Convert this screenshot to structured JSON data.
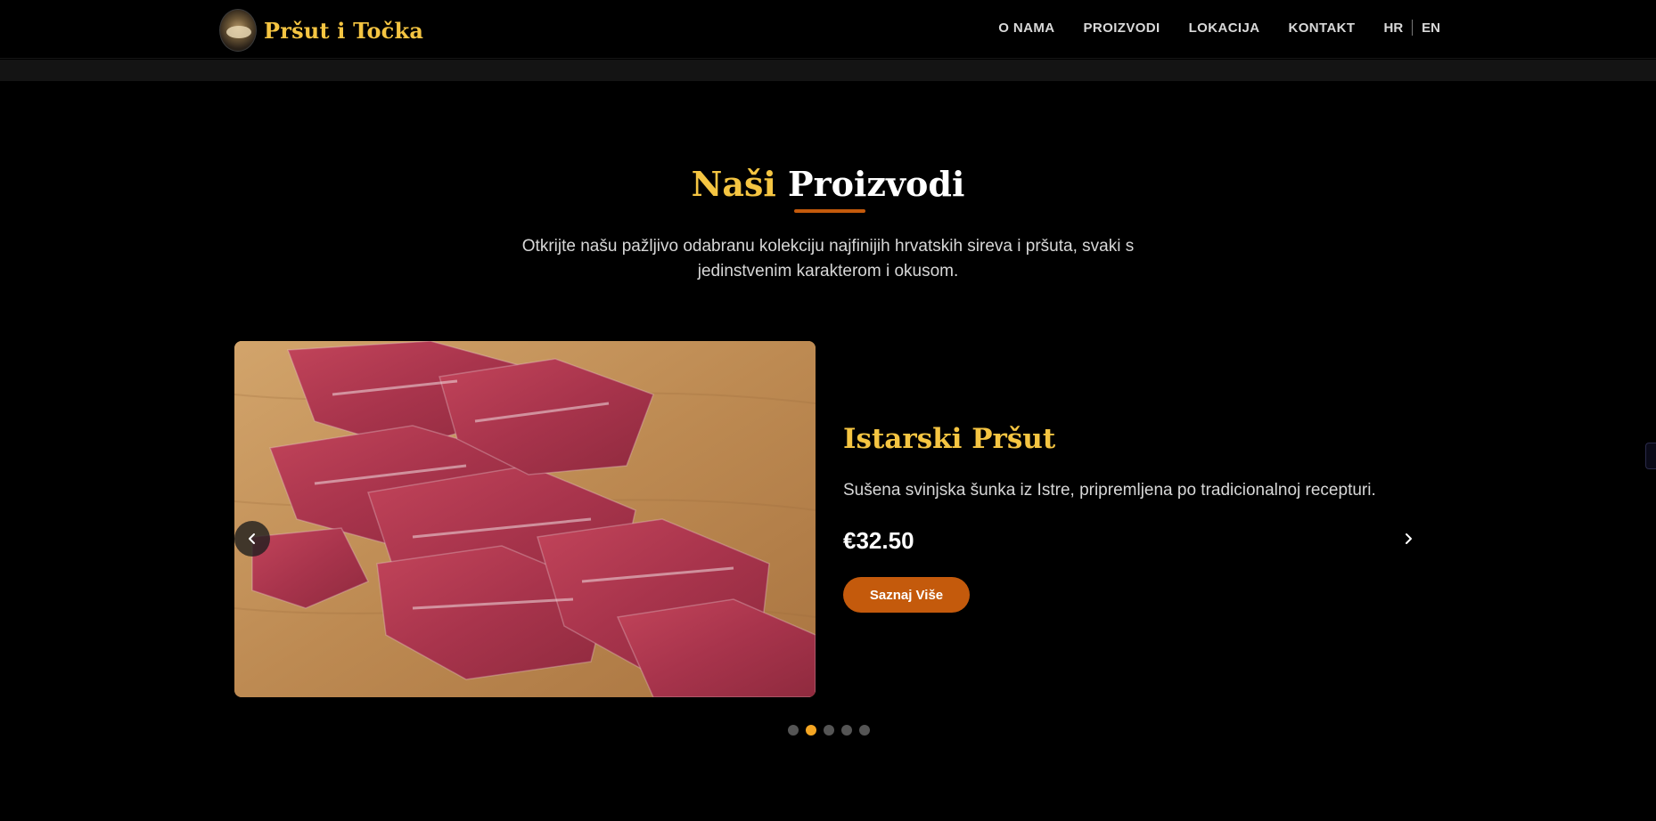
{
  "header": {
    "brand": "Pršut i Točka",
    "nav": [
      "O NAMA",
      "PROIZVODI",
      "LOKACIJA",
      "KONTAKT"
    ],
    "lang": {
      "hr": "HR",
      "en": "EN"
    }
  },
  "section": {
    "title_accent": "Naši",
    "title_rest": "Proizvodi",
    "intro": "Otkrijte našu pažljivo odabranu kolekciju najfinijih hrvatskih sireva i pršuta, svaki s jedinstvenim karakterom i okusom."
  },
  "slide": {
    "name": "Istarski Pršut",
    "description": "Sušena svinjska šunka iz Istre, pripremljena po tradicionalnoj recepturi.",
    "price": "€32.50",
    "cta": "Saznaj Više"
  },
  "carousel": {
    "slides": 5,
    "active": 2
  },
  "colors": {
    "accent": "#f5c542",
    "brand_orange": "#c45a0c",
    "dot_active": "#f5a623",
    "background": "#000000"
  }
}
